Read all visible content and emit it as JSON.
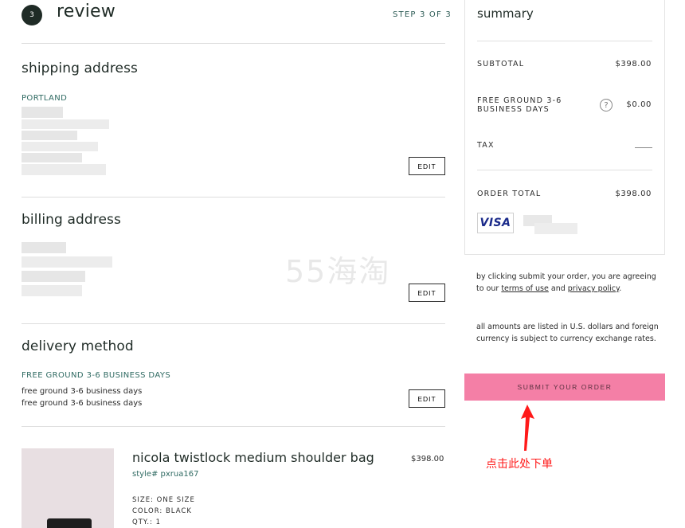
{
  "header": {
    "step_number": "3",
    "title": "review",
    "step_label": "STEP 3 OF 3"
  },
  "shipping": {
    "title": "shipping address",
    "city": "PORTLAND",
    "edit_label": "EDIT"
  },
  "billing": {
    "title": "billing address",
    "edit_label": "EDIT"
  },
  "delivery": {
    "title": "delivery method",
    "method_caps": "FREE GROUND 3-6 BUSINESS DAYS",
    "lines": [
      "free ground 3-6 business days",
      "free ground 3-6 business days"
    ],
    "edit_label": "EDIT"
  },
  "product": {
    "name": "nicola twistlock medium shoulder bag",
    "style": "style# pxrua167",
    "price": "$398.00",
    "size": "SIZE: ONE SIZE",
    "color": "COLOR: BLACK",
    "qty": "QTY.: 1"
  },
  "summary": {
    "title": "summary",
    "subtotal_label": "SUBTOTAL",
    "subtotal_value": "$398.00",
    "shipping_label_1": "FREE GROUND 3-6",
    "shipping_label_2": "BUSINESS DAYS",
    "shipping_help_icon": "?",
    "shipping_value": "$0.00",
    "tax_label": "TAX",
    "order_total_label": "ORDER TOTAL",
    "order_total_value": "$398.00",
    "card_brand": "VISA"
  },
  "legal": {
    "agree_prefix": "by clicking submit your order, you are agreeing to our ",
    "terms_link": "terms of use",
    "and_text": " and ",
    "privacy_link": "privacy policy",
    "agree_suffix": ".",
    "currency_note": "all amounts are listed in U.S. dollars and foreign currency is subject to currency exchange rates."
  },
  "submit": {
    "label": "SUBMIT YOUR ORDER"
  },
  "annotation": {
    "text": "点击此处下单"
  },
  "watermark": {
    "text": "55海淘"
  },
  "colors": {
    "accent_pink": "#f47fa6",
    "dark_green": "#1f2b26",
    "teal_text": "#2f6a62",
    "annotation_red": "#ff1a1a"
  }
}
